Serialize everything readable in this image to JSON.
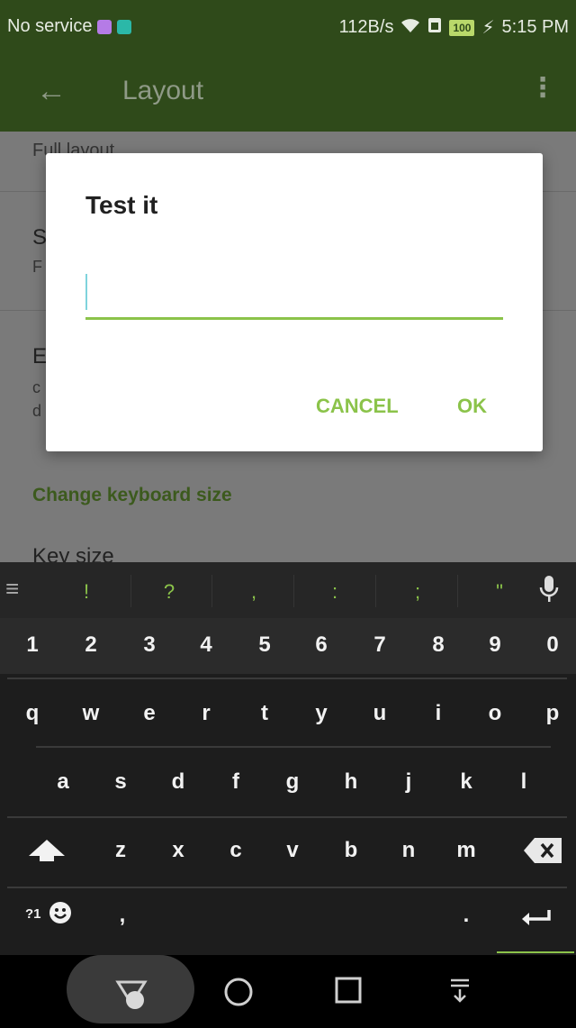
{
  "status_bar": {
    "carrier": "No service",
    "speed": "112B/s",
    "battery": "100",
    "time": "5:15 PM"
  },
  "app_bar": {
    "title": "Layout"
  },
  "background": {
    "item1_subtitle": "Full layout",
    "item2_title": "S",
    "item2_subtitle": "F",
    "item3_title": "E",
    "item3_line1": "c",
    "item3_line2": "d",
    "section_header": "Change keyboard size",
    "item4_title": "Key size"
  },
  "dialog": {
    "title": "Test it",
    "input_value": "",
    "cancel_label": "CANCEL",
    "ok_label": "OK"
  },
  "keyboard": {
    "suggestions": [
      "!",
      "?",
      ",",
      ":",
      ";",
      "\""
    ],
    "number_row": [
      "1",
      "2",
      "3",
      "4",
      "5",
      "6",
      "7",
      "8",
      "9",
      "0"
    ],
    "row1": [
      "q",
      "w",
      "e",
      "r",
      "t",
      "y",
      "u",
      "i",
      "o",
      "p"
    ],
    "row2": [
      "a",
      "s",
      "d",
      "f",
      "g",
      "h",
      "j",
      "k",
      "l"
    ],
    "row3": [
      "z",
      "x",
      "c",
      "v",
      "b",
      "n",
      "m"
    ],
    "symbols_label": "?1",
    "comma": ",",
    "period": "."
  },
  "colors": {
    "accent": "#8bc34a",
    "app_bar": "#2f4a1a"
  }
}
